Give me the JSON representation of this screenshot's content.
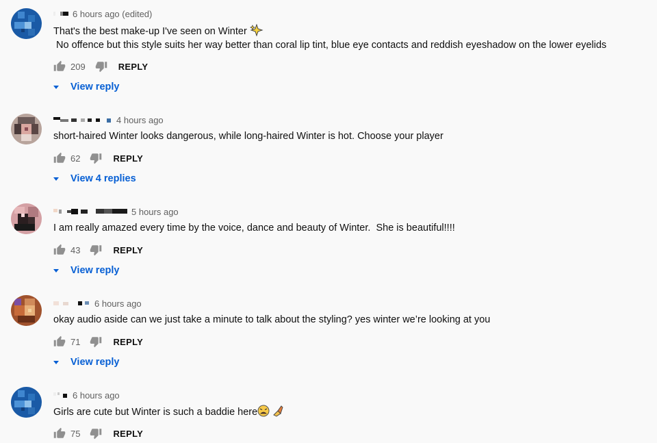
{
  "labels": {
    "reply": "REPLY"
  },
  "comments": [
    {
      "timestamp": "6 hours ago (edited)",
      "text_lines": [
        "That's the best make-up I've seen on Winter ",
        " No offence but this style suits her way better than coral lip tint, blue eye contacts and reddish eyeshadow on the lower eyelids"
      ],
      "emoji": "sparkles-icon",
      "likes": "209",
      "view_replies": "View reply"
    },
    {
      "timestamp": "4 hours ago",
      "text_lines": [
        "short-haired Winter looks dangerous, while long-haired Winter is hot. Choose your player"
      ],
      "likes": "62",
      "view_replies": "View 4 replies"
    },
    {
      "timestamp": "5 hours ago",
      "text_lines": [
        "I am really amazed every time by the voice, dance and beauty of Winter.  She is beautiful!!!!"
      ],
      "likes": "43",
      "view_replies": "View reply"
    },
    {
      "timestamp": "6 hours ago",
      "text_lines": [
        "okay audio aside can we just take a minute to talk about the styling? yes winter we’re looking at you"
      ],
      "likes": "71",
      "view_replies": "View reply"
    },
    {
      "timestamp": "6 hours ago",
      "text_lines": [
        "Girls are cute but Winter is such a baddie here"
      ],
      "emoji": [
        "weary-face-icon",
        "nail-polish-icon"
      ],
      "likes": "75"
    }
  ],
  "colors": {
    "link_blue": "#065fd4",
    "meta_gray": "#606060",
    "background": "#f9f9f9"
  }
}
